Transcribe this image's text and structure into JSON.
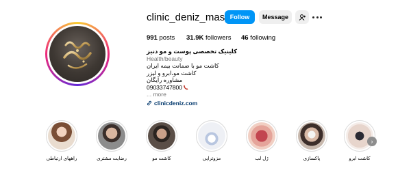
{
  "profile": {
    "username": "clinic_deniz_mashhad",
    "follow_label": "Follow",
    "message_label": "Message",
    "add_user_icon": "person-plus-icon",
    "more_icon": "ellipsis-icon"
  },
  "stats": {
    "posts_count": "991",
    "posts_label": "posts",
    "followers_count": "31.9K",
    "followers_label": "followers",
    "following_count": "46",
    "following_label": "following"
  },
  "bio": {
    "name": "کلینیک تخصصی پوست و مو دنیز",
    "category": "Health/beauty",
    "line1": "کاشت مو با ضمانت بیمه ایران",
    "line2": "کاشت مو،ابرو و لیزر",
    "line3": "مشاوره رایگان",
    "phone": "09033747800",
    "phone_icon": "phone-icon",
    "more": "... more",
    "link_icon": "link-icon",
    "link": "clinicdeniz.com"
  },
  "highlights": [
    {
      "label": "راههای ارتباطی"
    },
    {
      "label": "رضایت مشتری"
    },
    {
      "label": "کاشت مو"
    },
    {
      "label": "مزوتراپی"
    },
    {
      "label": "ژل لب"
    },
    {
      "label": "پاکسازی"
    },
    {
      "label": "کاشت ابرو"
    }
  ],
  "carousel_next_icon": "chevron-right-icon"
}
